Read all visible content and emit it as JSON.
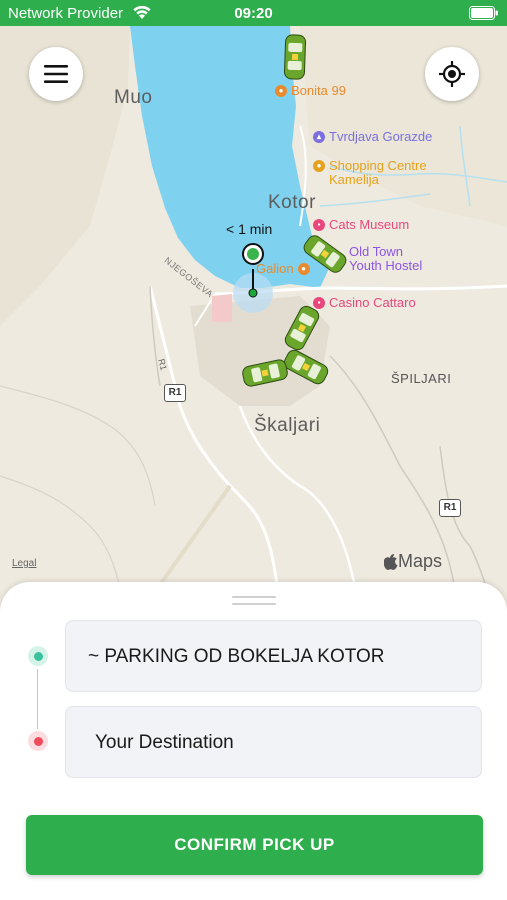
{
  "status_bar": {
    "carrier": "Network Provider",
    "time": "09:20"
  },
  "map": {
    "eta_label": "< 1 min",
    "towns": {
      "muo": "Muo",
      "kotor": "Kotor",
      "skaljari": "Škaljari",
      "spiljari": "ŠPILJARI"
    },
    "street_label": "NJEGOŠEVA",
    "road_shields": [
      "R1",
      "R1",
      "R1"
    ],
    "pois": [
      {
        "name": "Bonita 99",
        "color": "#e98a2c"
      },
      {
        "name": "Tvrdjava Gorazde",
        "color": "#7b6fe0"
      },
      {
        "name": "Shopping Centre Kamelija",
        "color": "#e6a21e"
      },
      {
        "name": "Cats Museum",
        "color": "#e7477d"
      },
      {
        "name": "Old Town Youth Hostel",
        "color": "#8b56e3"
      },
      {
        "name": "Galion",
        "color": "#e98a2c"
      },
      {
        "name": "Casino Cattaro",
        "color": "#e7477d"
      }
    ],
    "legal_link": "Legal",
    "brand": "Maps"
  },
  "booking": {
    "pickup_value": "~ PARKING OD BOKELJA KOTOR",
    "destination_placeholder": "Your Destination",
    "confirm_label": "CONFIRM PICK UP",
    "pickup_color": "#3cc29a",
    "destination_color": "#ef4b5c",
    "accent_color": "#2fae4d"
  }
}
